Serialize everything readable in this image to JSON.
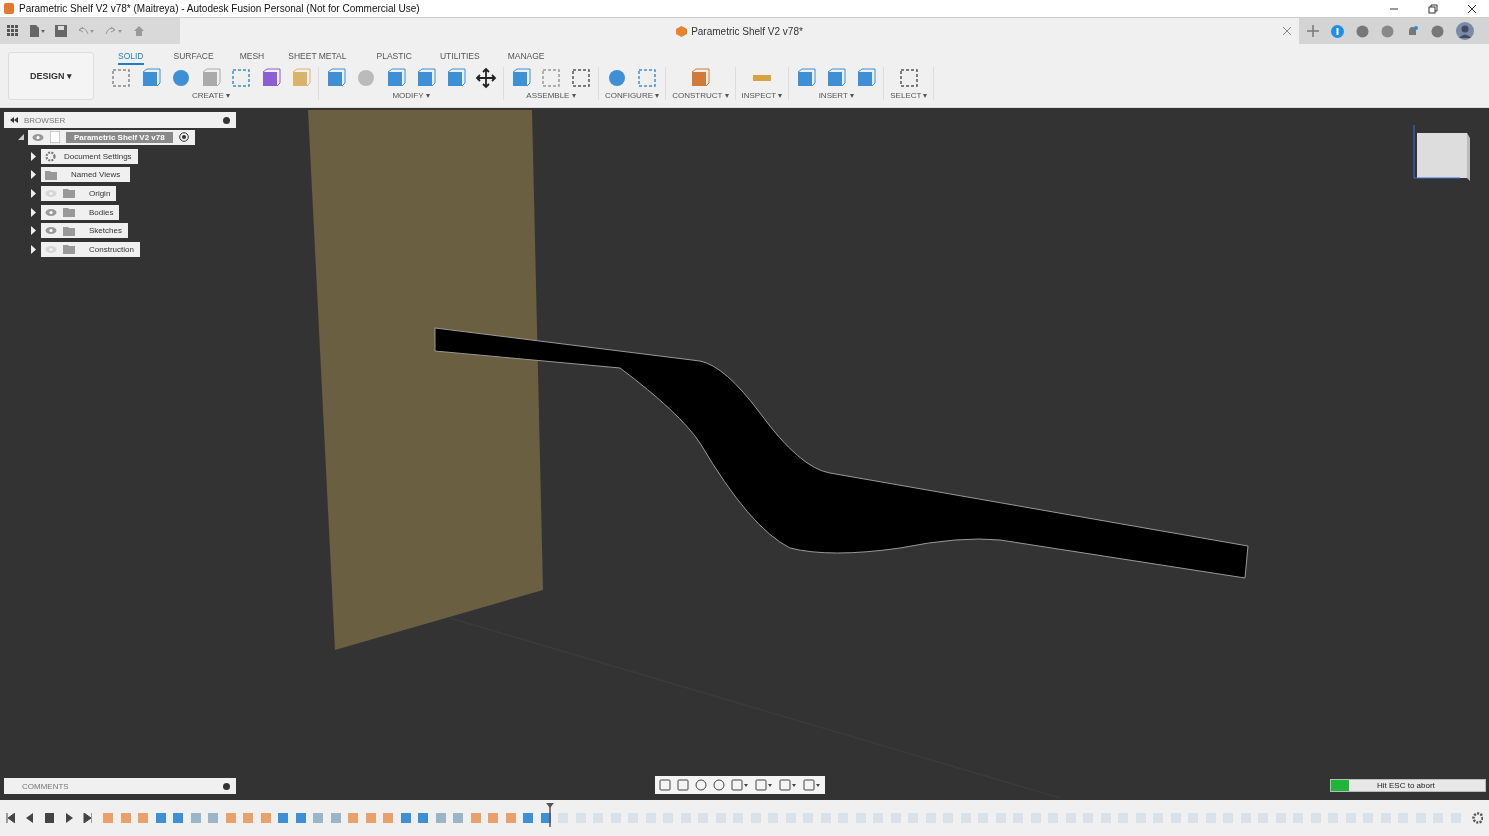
{
  "window": {
    "title": "Parametric Shelf V2 v78* (Maitreya) - Autodesk Fusion Personal (Not for Commercial Use)"
  },
  "document_tab": {
    "label": "Parametric Shelf V2 v78*"
  },
  "workspace": {
    "label": "DESIGN ▾"
  },
  "toolbar_tabs": [
    {
      "label": "SOLID",
      "selected": true
    },
    {
      "label": "SURFACE",
      "selected": false
    },
    {
      "label": "MESH",
      "selected": false
    },
    {
      "label": "SHEET METAL",
      "selected": false
    },
    {
      "label": "PLASTIC",
      "selected": false
    },
    {
      "label": "UTILITIES",
      "selected": false
    },
    {
      "label": "MANAGE",
      "selected": false
    }
  ],
  "toolbar_groups": [
    {
      "label": "CREATE ▾"
    },
    {
      "label": "MODIFY ▾"
    },
    {
      "label": "ASSEMBLE ▾"
    },
    {
      "label": "CONFIGURE ▾"
    },
    {
      "label": "CONSTRUCT ▾"
    },
    {
      "label": "INSPECT ▾"
    },
    {
      "label": "INSERT ▾"
    },
    {
      "label": "SELECT ▾"
    }
  ],
  "browser": {
    "title": "BROWSER",
    "root": {
      "label": "Parametric Shelf V2 v78",
      "visible": true,
      "children": [
        {
          "label": "Document Settings",
          "kind": "settings"
        },
        {
          "label": "Named Views",
          "kind": "folder"
        },
        {
          "label": "Origin",
          "kind": "folder",
          "visible": false
        },
        {
          "label": "Bodies",
          "kind": "folder",
          "visible": true
        },
        {
          "label": "Sketches",
          "kind": "folder",
          "visible": true
        },
        {
          "label": "Construction",
          "kind": "folder",
          "visible": false
        }
      ]
    }
  },
  "comments": {
    "title": "COMMENTS"
  },
  "progress": {
    "label": "Hit ESC to abort",
    "level": 0.12
  }
}
